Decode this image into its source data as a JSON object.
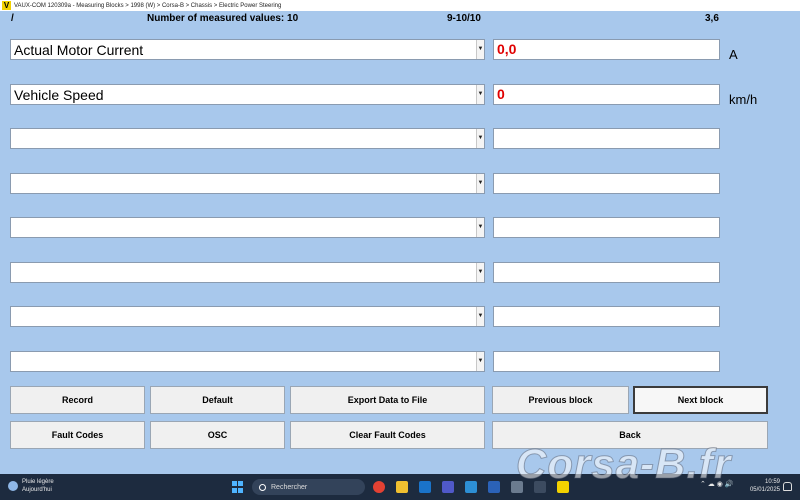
{
  "window": {
    "title": "VAUX-COM 120309a - Measuring Blocks > 1998 (W) > Corsa-B > Chassis > Electric Power Steering"
  },
  "header": {
    "slash": "/",
    "count_label": "Number of measured values: 10",
    "range": "9-10/10",
    "value": "3,6"
  },
  "rows": [
    {
      "label": "Actual Motor Current",
      "value": "0,0",
      "unit": "A"
    },
    {
      "label": "Vehicle Speed",
      "value": "0",
      "unit": "km/h"
    },
    {
      "label": "",
      "value": "",
      "unit": ""
    },
    {
      "label": "",
      "value": "",
      "unit": ""
    },
    {
      "label": "",
      "value": "",
      "unit": ""
    },
    {
      "label": "",
      "value": "",
      "unit": ""
    },
    {
      "label": "",
      "value": "",
      "unit": ""
    },
    {
      "label": "",
      "value": "",
      "unit": ""
    }
  ],
  "buttons": {
    "record": "Record",
    "default": "Default",
    "export": "Export Data to File",
    "previous_block": "Previous block",
    "next_block": "Next block",
    "fault_codes": "Fault Codes",
    "osc": "OSC",
    "clear_fault_codes": "Clear Fault Codes",
    "back": "Back"
  },
  "taskbar": {
    "weather_line1": "Pluie légère",
    "weather_line2": "Aujourd'hui",
    "search_placeholder": "Rechercher",
    "time": "10:59",
    "date": "05/01/2025"
  },
  "watermark": "Corsa-B.fr",
  "colors": {
    "background": "#a8c8ec",
    "value_red": "#e00000",
    "app_icon": "#f2d100"
  },
  "icons": {
    "app": "vaux-com-icon",
    "start": "windows-start-icon",
    "search": "search-icon",
    "weather": "rain-cloud-icon",
    "notification": "bell-icon"
  }
}
